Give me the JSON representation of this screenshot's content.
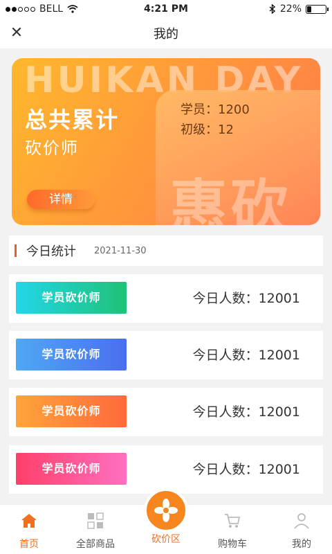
{
  "status_bar": {
    "carrier": "BELL",
    "time": "4:21 PM",
    "battery": "22%",
    "battery_level": 0.22
  },
  "nav": {
    "title": "我的",
    "close_icon": "close-icon"
  },
  "hero": {
    "watermark": "HUIKAN DAY",
    "big_chars": "惠砍",
    "title": "总共累计",
    "subtitle": "砍价师",
    "stats": [
      "学员：1200",
      "初级：12"
    ],
    "detail_label": "详情"
  },
  "today": {
    "title": "今日统计",
    "date": "2021-11-30"
  },
  "cards": [
    {
      "label": "学员砍价师",
      "count": "今日人数：12001",
      "color_start": "#22d6e8",
      "color_end": "#1fc277"
    },
    {
      "label": "学员砍价师",
      "count": "今日人数：12001",
      "color_start": "#4fa8f5",
      "color_end": "#4a6ef0"
    },
    {
      "label": "学员砍价师",
      "count": "今日人数：12001",
      "color_start": "#ffa43a",
      "color_end": "#ff6a3a"
    },
    {
      "label": "学员砍价师",
      "count": "今日人数：12001",
      "color_start": "#ff3f6a",
      "color_end": "#ff6fc0"
    }
  ],
  "tabs": [
    {
      "label": "首页",
      "icon": "home-icon"
    },
    {
      "label": "全部商品",
      "icon": "grid-icon"
    },
    {
      "label": "砍价区",
      "icon": "flower-icon"
    },
    {
      "label": "购物车",
      "icon": "cart-icon"
    },
    {
      "label": "我的",
      "icon": "user-icon"
    }
  ],
  "colors": {
    "accent": "#f07020",
    "hero_start": "#ffb82c",
    "hero_end": "#ff7a4a"
  }
}
